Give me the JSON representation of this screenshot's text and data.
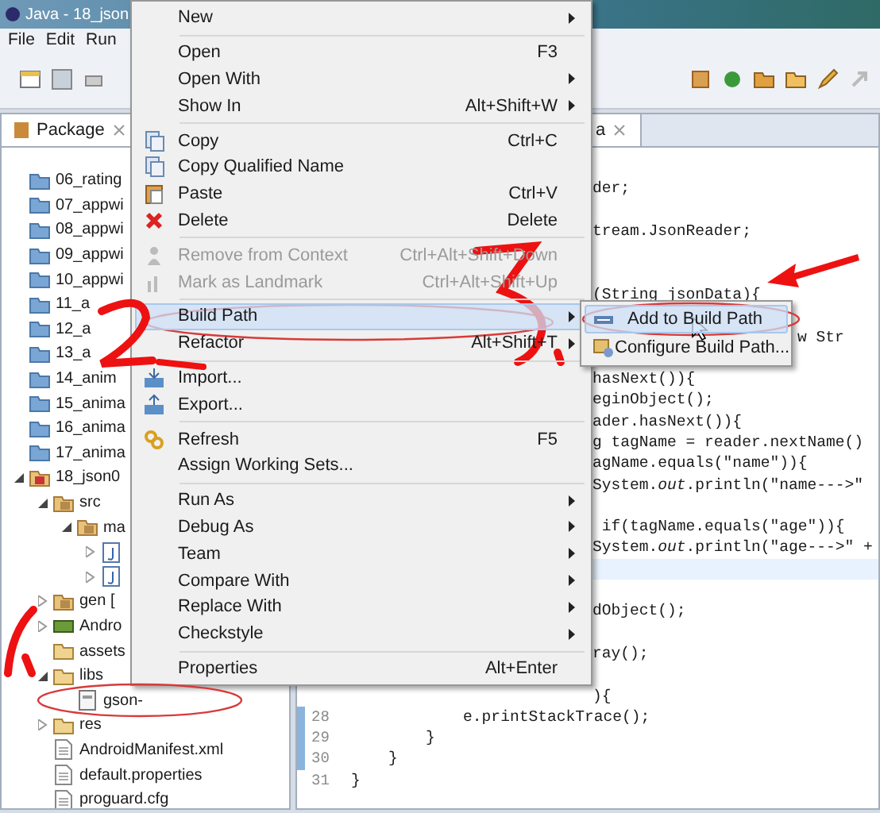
{
  "window": {
    "title": "Java - 18_json"
  },
  "menubar": [
    "File",
    "Edit",
    "Run"
  ],
  "package_explorer": {
    "tab": "Package",
    "tree": [
      {
        "label": "06_rating",
        "kind": "project"
      },
      {
        "label": "07_appwi",
        "kind": "project"
      },
      {
        "label": "08_appwi",
        "kind": "project"
      },
      {
        "label": "09_appwi",
        "kind": "project"
      },
      {
        "label": "10_appwi",
        "kind": "project"
      },
      {
        "label": "11_a",
        "kind": "project"
      },
      {
        "label": "12_a",
        "kind": "project"
      },
      {
        "label": "13_a",
        "kind": "project"
      },
      {
        "label": "14_anim",
        "kind": "project"
      },
      {
        "label": "15_anima",
        "kind": "project"
      },
      {
        "label": "16_anima",
        "kind": "project"
      },
      {
        "label": "17_anima",
        "kind": "project"
      },
      {
        "label": "18_json0",
        "kind": "open-project",
        "expanded": true,
        "children": [
          {
            "label": "src",
            "kind": "package",
            "expanded": true,
            "children": [
              {
                "label": "ma",
                "kind": "package",
                "expanded": true,
                "children": [
                  {
                    "kind": "java",
                    "expanded": false
                  },
                  {
                    "kind": "java",
                    "expanded": false
                  }
                ]
              }
            ]
          },
          {
            "label": "gen [",
            "kind": "package",
            "expanded": false
          },
          {
            "label": "Andro",
            "kind": "library",
            "expanded": false
          },
          {
            "label": "assets",
            "kind": "folder"
          },
          {
            "label": "libs",
            "kind": "folder",
            "expanded": true,
            "children": [
              {
                "label": "gson-",
                "kind": "jar"
              }
            ]
          },
          {
            "label": "res",
            "kind": "folder",
            "expanded": false
          },
          {
            "label": "AndroidManifest.xml",
            "kind": "file"
          },
          {
            "label": "default.properties",
            "kind": "file"
          },
          {
            "label": "proguard.cfg",
            "kind": "file"
          }
        ]
      }
    ]
  },
  "editor": {
    "tab": "a",
    "lines": [
      {
        "kind": "clipped",
        "current": false
      },
      {
        "kind": "clipped",
        "code": "der;",
        "current": false
      },
      {
        "kind": "clipped",
        "current": false
      },
      {
        "kind": "clipped",
        "code": "tream.JsonReader;",
        "current": false
      },
      {
        "kind": "clipped",
        "current": false
      },
      {
        "kind": "clipped",
        "current": false
      },
      {
        "kind": "clipped",
        "code": "(String jsonData){",
        "current": false
      },
      {
        "kind": "clipped",
        "current": false
      },
      {
        "kind": "far",
        "code": "w Str",
        "current": false
      },
      {
        "kind": "clipped",
        "current": false
      },
      {
        "kind": "clipped",
        "code": "hasNext()){",
        "current": false
      },
      {
        "kind": "clipped",
        "code": "eginObject();",
        "current": false
      },
      {
        "kind": "clipped",
        "code": "ader.hasNext()){",
        "current": false
      },
      {
        "kind": "clipped",
        "code": "g tagName = reader.nextName()",
        "current": false
      },
      {
        "kind": "clipped",
        "code": "agName.equals(\"name\")){",
        "current": false
      },
      {
        "kind": "clipped",
        "code": "System.*out*.println(\"name--->\"",
        "current": false
      },
      {
        "kind": "clipped",
        "current": false
      },
      {
        "kind": "clipped",
        "code": " if(tagName.equals(\"age\")){",
        "current": false
      },
      {
        "kind": "clipped",
        "code": "System.*out*.println(\"age--->\" +",
        "current": false
      },
      {
        "kind": "clipped",
        "current": true
      },
      {
        "kind": "clipped",
        "current": false
      },
      {
        "kind": "clipped",
        "code": "dObject();",
        "current": false
      },
      {
        "kind": "clipped",
        "current": false
      },
      {
        "kind": "clipped",
        "code": "ray();",
        "current": false
      },
      {
        "kind": "clipped",
        "current": false
      },
      {
        "kind": "clipped",
        "code": "){",
        "current": false
      },
      {
        "kind": "numbered",
        "number": "28",
        "code": "            e.printStackTrace();",
        "current": false
      },
      {
        "kind": "numbered",
        "number": "29",
        "code": "        }",
        "current": false
      },
      {
        "kind": "numbered",
        "number": "30",
        "code": "    }",
        "current": false
      },
      {
        "kind": "numbered",
        "number": "31",
        "code": "}",
        "current": false
      }
    ]
  },
  "context_menu": {
    "items": [
      {
        "kind": "plain",
        "label": "New",
        "submenu": true,
        "disabled": false,
        "selected": false
      },
      {
        "kind": "separator"
      },
      {
        "kind": "plain",
        "label": "Open",
        "shortcut": "F3",
        "submenu": false,
        "disabled": false,
        "selected": false
      },
      {
        "kind": "plain",
        "label": "Open With",
        "submenu": true,
        "disabled": false,
        "selected": false
      },
      {
        "kind": "plain",
        "label": "Show In",
        "shortcut": "Alt+Shift+W",
        "submenu": true,
        "disabled": false,
        "selected": false
      },
      {
        "kind": "separator"
      },
      {
        "kind": "copy",
        "label": "Copy",
        "shortcut": "Ctrl+C",
        "submenu": false,
        "disabled": false,
        "selected": false
      },
      {
        "kind": "copy",
        "label": "Copy Qualified Name",
        "submenu": false,
        "disabled": false,
        "selected": false
      },
      {
        "kind": "paste",
        "label": "Paste",
        "shortcut": "Ctrl+V",
        "submenu": false,
        "disabled": false,
        "selected": false
      },
      {
        "kind": "delete",
        "label": "Delete",
        "shortcut": "Delete",
        "submenu": false,
        "disabled": false,
        "selected": false
      },
      {
        "kind": "separator"
      },
      {
        "kind": "remove",
        "label": "Remove from Context",
        "shortcut": "Ctrl+Alt+Shift+Down",
        "submenu": false,
        "disabled": true,
        "selected": false
      },
      {
        "kind": "landmark",
        "label": "Mark as Landmark",
        "shortcut": "Ctrl+Alt+Shift+Up",
        "submenu": false,
        "disabled": true,
        "selected": false
      },
      {
        "kind": "separator"
      },
      {
        "kind": "plain",
        "label": "Build Path",
        "submenu": true,
        "disabled": false,
        "selected": true
      },
      {
        "kind": "plain",
        "label": "Refactor",
        "shortcut": "Alt+Shift+T",
        "submenu": true,
        "disabled": false,
        "selected": false
      },
      {
        "kind": "separator"
      },
      {
        "kind": "import",
        "label": "Import...",
        "submenu": false,
        "disabled": false,
        "selected": false
      },
      {
        "kind": "export",
        "label": "Export...",
        "submenu": false,
        "disabled": false,
        "selected": false
      },
      {
        "kind": "separator"
      },
      {
        "kind": "refresh",
        "label": "Refresh",
        "shortcut": "F5",
        "submenu": false,
        "disabled": false,
        "selected": false
      },
      {
        "kind": "plain",
        "label": "Assign Working Sets...",
        "submenu": false,
        "disabled": false,
        "selected": false
      },
      {
        "kind": "separator"
      },
      {
        "kind": "plain",
        "label": "Run As",
        "submenu": true,
        "disabled": false,
        "selected": false
      },
      {
        "kind": "plain",
        "label": "Debug As",
        "submenu": true,
        "disabled": false,
        "selected": false
      },
      {
        "kind": "plain",
        "label": "Team",
        "submenu": true,
        "disabled": false,
        "selected": false
      },
      {
        "kind": "plain",
        "label": "Compare With",
        "submenu": true,
        "disabled": false,
        "selected": false
      },
      {
        "kind": "plain",
        "label": "Replace With",
        "submenu": true,
        "disabled": false,
        "selected": false
      },
      {
        "kind": "plain",
        "label": "Checkstyle",
        "submenu": true,
        "disabled": false,
        "selected": false
      },
      {
        "kind": "separator"
      },
      {
        "kind": "plain",
        "label": "Properties",
        "shortcut": "Alt+Enter",
        "submenu": false,
        "disabled": false,
        "selected": false
      }
    ]
  },
  "submenu": {
    "items": [
      {
        "label": "Add to Build Path",
        "kind": "add",
        "selected": true
      },
      {
        "label": "Configure Build Path...",
        "kind": "configure",
        "selected": false
      }
    ]
  }
}
